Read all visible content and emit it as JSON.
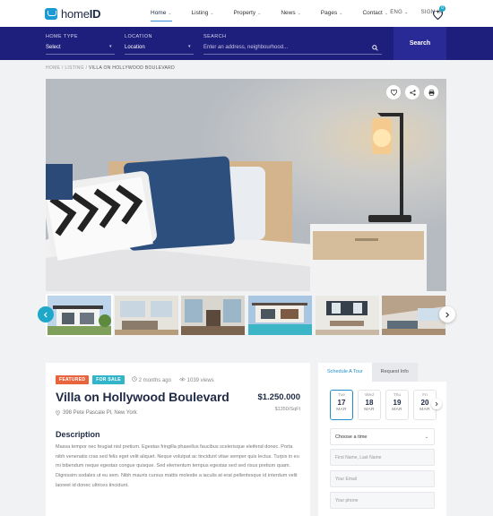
{
  "header": {
    "logo_prefix": "home",
    "logo_suffix": "ID",
    "nav": [
      {
        "label": "Home",
        "active": true
      },
      {
        "label": "Listing",
        "active": false
      },
      {
        "label": "Property",
        "active": false
      },
      {
        "label": "News",
        "active": false
      },
      {
        "label": "Pages",
        "active": false
      },
      {
        "label": "Contact",
        "active": false
      }
    ],
    "lang": "ENG",
    "signin": "SIGN IN",
    "wishlist_count": "0"
  },
  "search": {
    "home_type_label": "HOME TYPE",
    "home_type_value": "Select",
    "location_label": "LOCATION",
    "location_value": "Location",
    "search_label": "SEARCH",
    "search_placeholder": "Enter an address, neighbourhood...",
    "button": "Search"
  },
  "breadcrumb": {
    "home": "HOME",
    "listing": "LISTING",
    "current": "VILLA ON HOLLYWOOD BOULEVARD",
    "sep": "/"
  },
  "listing": {
    "badge_featured": "FEATURED",
    "badge_forsale": "FOR SALE",
    "posted": "2 months ago",
    "views": "1039 views",
    "title": "Villa on Hollywood Boulevard",
    "price": "$1.250.000",
    "price_sqft": "$1350/SqFt",
    "address": "398 Pete Pascale Pl, New York",
    "desc_heading": "Description",
    "description": "Massa tempor nec feugiat nisl pretium. Egestas fringilla phasellus faucibus scelerisque eleifend donec. Porta nibh venenatis cras sed felis eget velit aliquet. Neque volutpat ac tincidunt vitae semper quis lectus. Turpis in eu mi bibendum neque egestas congue quisque. Sed elementum tempus egestas sed sed risus pretium quam. Dignissim sodales ut eu sem. Nibh mauris cursus mattis molestie a iaculis at erat pellentesque id interdum velit laoreet id donec ultrices tincidunt."
  },
  "tour": {
    "tab_schedule": "Schedule A Tour",
    "tab_request": "Request Info",
    "dates": [
      {
        "dow": "Tue",
        "day": "17",
        "mon": "MAR",
        "selected": true
      },
      {
        "dow": "Wed",
        "day": "18",
        "mon": "MAR",
        "selected": false
      },
      {
        "dow": "Thu",
        "day": "19",
        "mon": "MAR",
        "selected": false
      },
      {
        "dow": "Fri",
        "day": "20",
        "mon": "MAR",
        "selected": false
      }
    ],
    "time_placeholder": "Choose a time",
    "name_placeholder": "First Name, Last Name",
    "email_placeholder": "Your Email",
    "phone_placeholder": "Your phone"
  },
  "colors": {
    "navy": "#1e1e7c",
    "accent": "#1ea7c8",
    "featured_badge": "#e8643c",
    "forsale_badge": "#33b5c9"
  }
}
